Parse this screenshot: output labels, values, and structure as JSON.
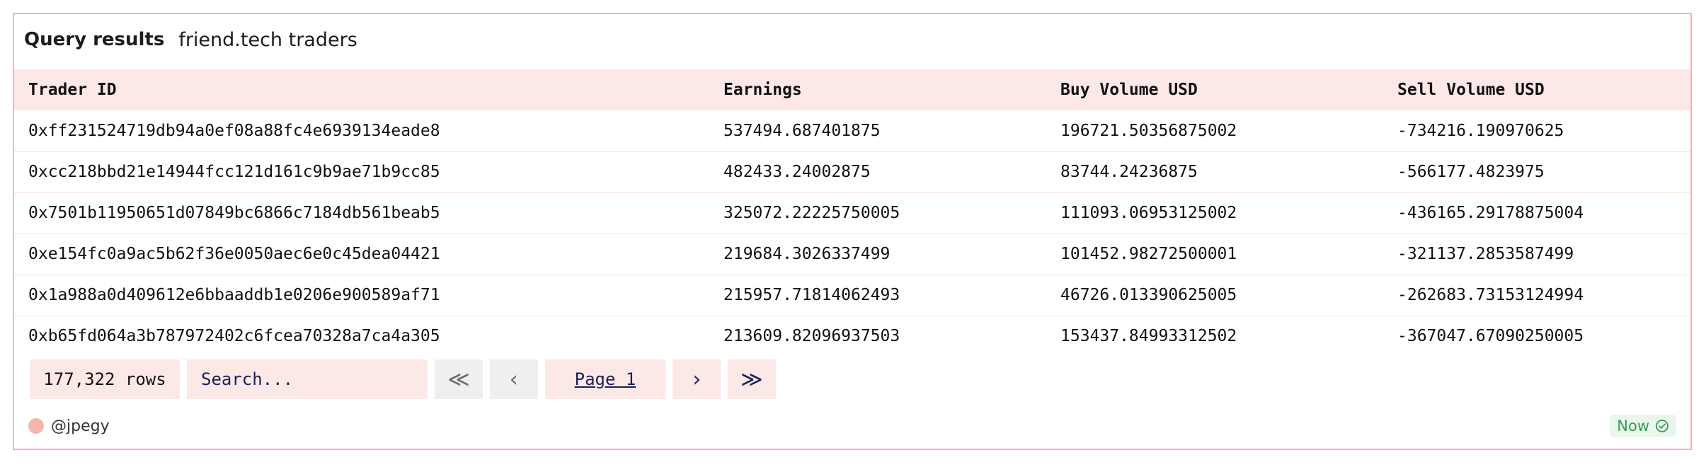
{
  "header": {
    "title": "Query results",
    "subtitle": "friend.tech traders"
  },
  "table": {
    "columns": [
      "Trader ID",
      "Earnings",
      "Buy Volume USD",
      "Sell Volume USD"
    ],
    "rows": [
      [
        "0xff231524719db94a0ef08a88fc4e6939134eade8",
        "537494.687401875",
        "196721.50356875002",
        "-734216.190970625"
      ],
      [
        "0xcc218bbd21e14944fcc121d161c9b9ae71b9cc85",
        "482433.24002875",
        "83744.24236875",
        "-566177.4823975"
      ],
      [
        "0x7501b11950651d07849bc6866c7184db561beab5",
        "325072.22225750005",
        "111093.06953125002",
        "-436165.29178875004"
      ],
      [
        "0xe154fc0a9ac5b62f36e0050aec6e0c45dea04421",
        "219684.3026337499",
        "101452.98272500001",
        "-321137.2853587499"
      ],
      [
        "0x1a988a0d409612e6bbaaddb1e0206e900589af71",
        "215957.71814062493",
        "46726.013390625005",
        "-262683.73153124994"
      ],
      [
        "0xb65fd064a3b787972402c6fcea70328a7ca4a305",
        "213609.82096937503",
        "153437.84993312502",
        "-367047.67090250005"
      ]
    ]
  },
  "pager": {
    "rows_count": "177,322 rows",
    "search_placeholder": "Search...",
    "first_icon": "≪",
    "prev_icon": "‹",
    "page_label": "Page 1",
    "next_icon": "›",
    "last_icon": "≫"
  },
  "footer": {
    "user": "@jpegy",
    "status": "Now",
    "status_icon": "check-circle-icon"
  },
  "colors": {
    "accent": "#f2b7ad",
    "row_header_bg": "#fce9e7",
    "link": "#1d2057",
    "status_green": "#3a9a5a"
  }
}
